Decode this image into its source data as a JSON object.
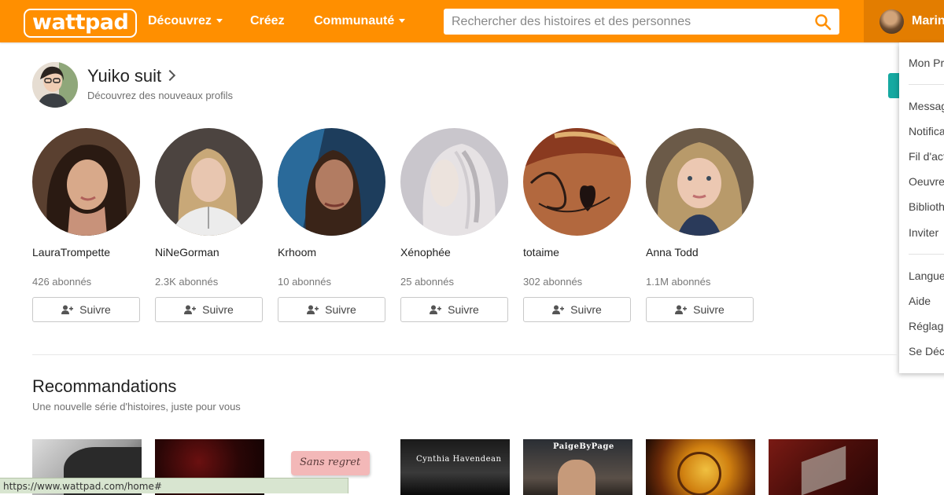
{
  "header": {
    "logo": "wattpad",
    "nav": [
      "Découvrez",
      "Créez",
      "Communauté"
    ],
    "search_placeholder": "Rechercher des histoires et des personnes",
    "user_name": "Marine",
    "brand_color": "#ff8f00"
  },
  "dropdown": {
    "items_group1": [
      "Mon Profil"
    ],
    "items_group2": [
      "Messages",
      "Notifications",
      "Fil d'actualité",
      "Oeuvres",
      "Bibliothèque",
      "Inviter"
    ],
    "items_group3": [
      "Langue",
      "Aide",
      "Réglages",
      "Se Déconnecter"
    ]
  },
  "follow": {
    "title": "Yuiko suit",
    "subtitle": "Découvrez des nouveaux profils",
    "follow_label": "Suivre",
    "profiles": [
      {
        "name": "LauraTrompette",
        "followers": "426 abonnés"
      },
      {
        "name": "NiNeGorman",
        "followers": "2.3K abonnés"
      },
      {
        "name": "Krhoom",
        "followers": "10 abonnés"
      },
      {
        "name": "Xénophée",
        "followers": "25 abonnés"
      },
      {
        "name": "totaime",
        "followers": "302 abonnés"
      },
      {
        "name": "Anna Todd",
        "followers": "1.1M abonnés"
      }
    ]
  },
  "recommendations": {
    "title": "Recommandations",
    "subtitle": "Une nouvelle série d'histoires, juste pour vous",
    "cover_texts": [
      "Sans regret",
      "Cynthia Havendean",
      "PaigeByPage"
    ]
  },
  "status_bar": {
    "url": "https://www.wattpad.com/home#"
  }
}
